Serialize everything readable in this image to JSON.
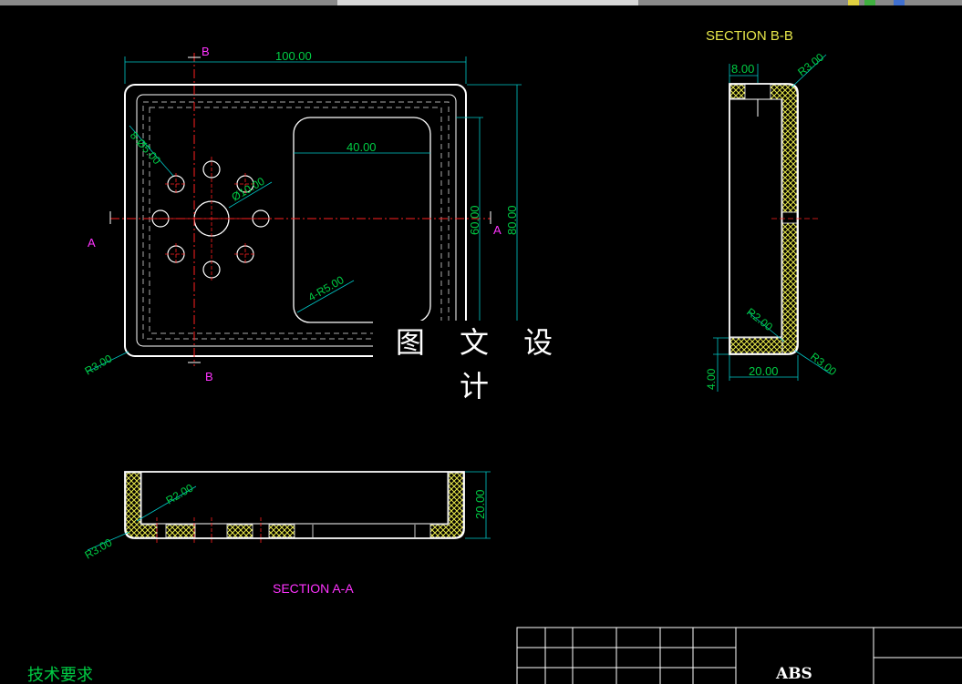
{
  "watermark": "图 文 设 计",
  "colors": {
    "background": "#000000",
    "outline": "#ffffff",
    "dimension": "#00cc44",
    "extension": "#00c8c8",
    "centerline": "#ff2020",
    "section_label": "#ff33ff",
    "section_title": "#e8e84a",
    "hatch": "#e8e84a",
    "hidden": "#aaaaaa"
  },
  "top_view": {
    "section_cut_top": "B",
    "section_cut_bottom": "B",
    "section_cut_left": "A",
    "section_cut_right": "A",
    "dim_width": "100.00",
    "dim_height": "80.00",
    "dim_window_height": "60.00",
    "dim_window_width": "40.00",
    "dim_small_holes": "8-Ø5.00",
    "dim_center_hole": "Ø10.00",
    "dim_window_radius": "4-R5.00",
    "dim_corner_radius": "R3.00"
  },
  "section_bb": {
    "title": "SECTION B-B",
    "dim_wall": "8.00",
    "dim_outer_radius_top": "R3.00",
    "dim_inner_radius": "R2.00",
    "dim_outer_radius_bottom": "R3.00",
    "dim_depth": "20.00",
    "dim_floor": "4.00"
  },
  "section_aa": {
    "title": "SECTION A-A",
    "dim_inner_radius": "R2.00",
    "dim_outer_radius": "R3.00",
    "dim_depth": "20.00"
  },
  "notes": {
    "tech_requirements": "技术要求"
  },
  "title_block": {
    "material": "ABS"
  }
}
